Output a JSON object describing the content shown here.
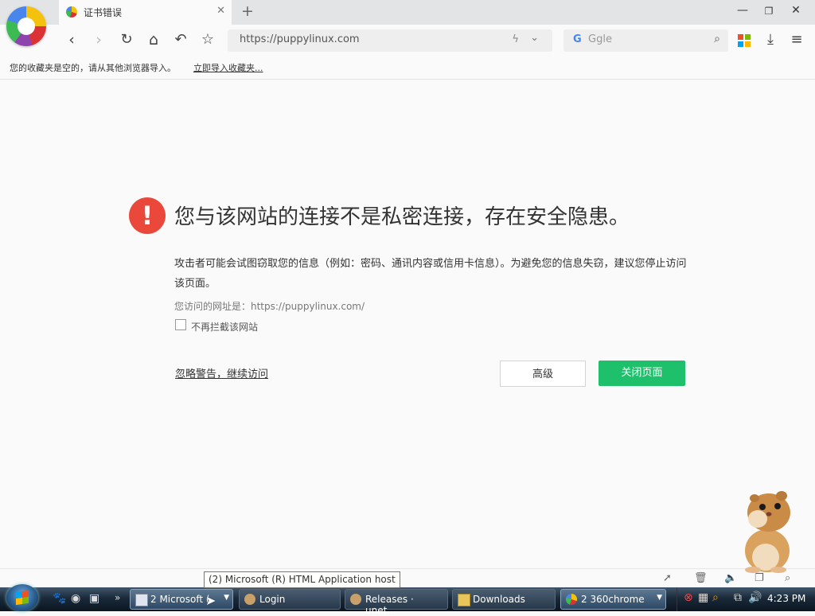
{
  "browser": {
    "tab_title": "证书错误",
    "tab_close": "✕",
    "new_tab": "+",
    "url": "https://puppylinux.com",
    "search_placeholder": "Ggle",
    "search_engine_letter": "G",
    "bookmarks_message": "您的收藏夹是空的，请从其他浏览器导入。",
    "bookmarks_import_link": "立即导入收藏夹..."
  },
  "page": {
    "headline": "您与该网站的连接不是私密连接，存在安全隐患。",
    "description": "攻击者可能会试图窃取您的信息（例如：密码、通讯内容或信用卡信息）。为避免您的信息失窃，建议您停止访问该页面。",
    "visited_url_label": "您访问的网址是：https://puppylinux.com/",
    "dont_block_label": "不再拦截该网站",
    "ignore_link": "忽略警告，继续访问",
    "advanced_button": "高级",
    "close_button": "关闭页面",
    "warning_symbol": "!"
  },
  "statusbar": {
    "tooltip": "(2) Microsoft (R) HTML Application host"
  },
  "taskbar": {
    "tasks": [
      {
        "label": "2 Microsoft (",
        "icon": "window-icon"
      },
      {
        "label": "Login",
        "icon": "puppy-icon"
      },
      {
        "label": "Releases · unet...",
        "icon": "puppy-icon"
      },
      {
        "label": "Downloads",
        "icon": "folder-icon"
      },
      {
        "label": "2 360chrome",
        "icon": "360chrome-icon"
      }
    ],
    "clock": "4:23 PM",
    "overflow": "»"
  },
  "colors": {
    "warning_red": "#e9483b",
    "close_button_green": "#1fc06b"
  }
}
